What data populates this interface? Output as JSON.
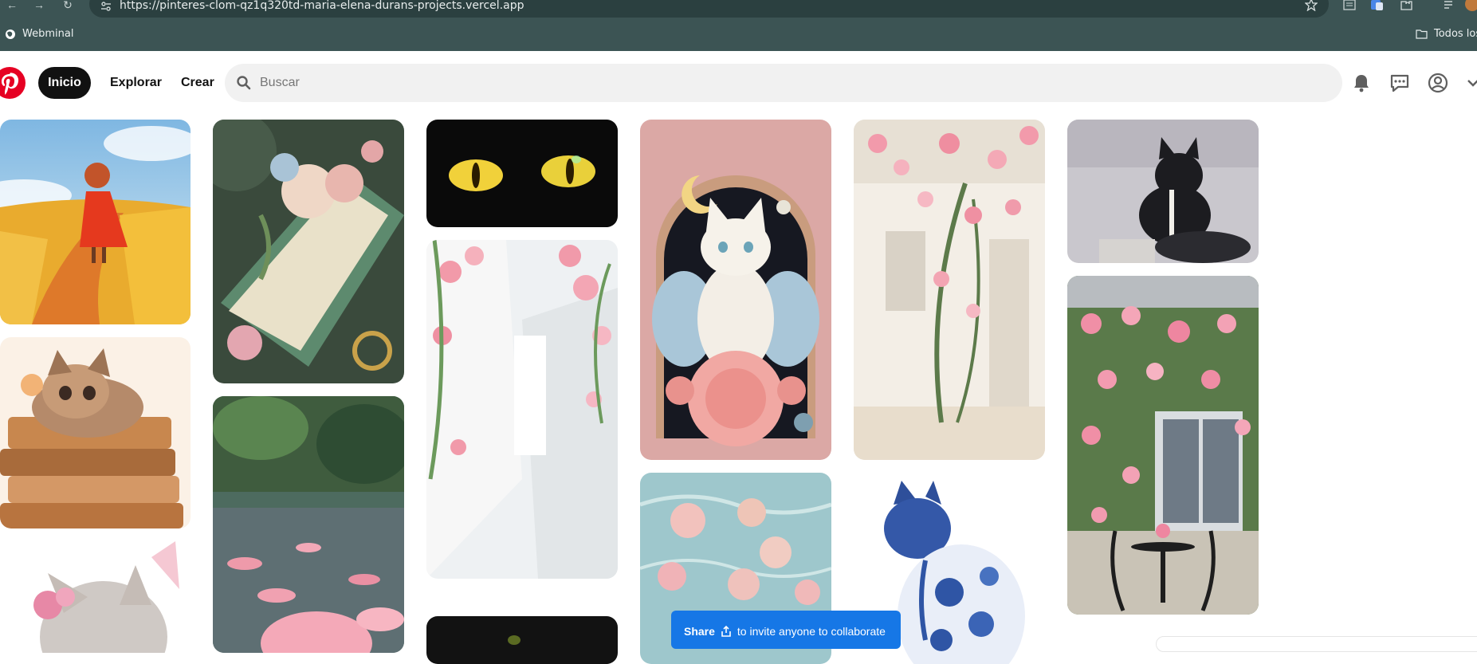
{
  "browser": {
    "url": "https://pinteres-clom-qz1q320td-maria-elena-durans-projects.vercel.app",
    "bookmarks": [
      {
        "label": "Webminal",
        "icon": "globe-icon"
      },
      {
        "label": "Todos los",
        "icon": "folder-icon"
      }
    ],
    "colors": {
      "chrome": "#3c5454",
      "url_bar": "#2b4040"
    }
  },
  "header": {
    "logo_icon": "pinterest-logo",
    "nav": {
      "home": "Inicio",
      "explore": "Explorar",
      "create": "Crear"
    },
    "search": {
      "placeholder": "Buscar",
      "value": ""
    },
    "icons": [
      "bell-icon",
      "message-icon",
      "profile-icon",
      "chevron-down-icon"
    ]
  },
  "pins": [
    {
      "name": "pin-girl-wheat-field",
      "subject": "girl in red dress in wheat field"
    },
    {
      "name": "pin-kitten-books",
      "subject": "kitten sleeping on stack of books"
    },
    {
      "name": "pin-kitten-flowers",
      "subject": "kitten with pink flowers"
    },
    {
      "name": "pin-roses-book",
      "subject": "roses on an old green book"
    },
    {
      "name": "pin-pink-pond",
      "subject": "pink flowers floating on a pond"
    },
    {
      "name": "pin-cat-eyes",
      "subject": "yellow cat eyes in darkness"
    },
    {
      "name": "pin-rose-alley",
      "subject": "white alley with climbing roses"
    },
    {
      "name": "pin-dark-plant",
      "subject": "dark image with plant"
    },
    {
      "name": "pin-fairy-cat",
      "subject": "white cat with butterfly wings on a rose"
    },
    {
      "name": "pin-water-roses",
      "subject": "roses floating in water"
    },
    {
      "name": "pin-rose-wall",
      "subject": "roses climbing a white wall"
    },
    {
      "name": "pin-blue-cat",
      "subject": "blue porcelain-pattern cat"
    },
    {
      "name": "pin-black-cat",
      "subject": "black cat stirring a cauldron"
    },
    {
      "name": "pin-rose-house",
      "subject": "roses over a window with garden table"
    }
  ],
  "share_toast": {
    "bold": "Share",
    "text": "to invite anyone to collaborate",
    "icon": "share-icon"
  },
  "colors": {
    "brand": "#e60023",
    "active_nav": "#111111",
    "search_bg": "#f1f1f1",
    "toast": "#1677e6"
  }
}
